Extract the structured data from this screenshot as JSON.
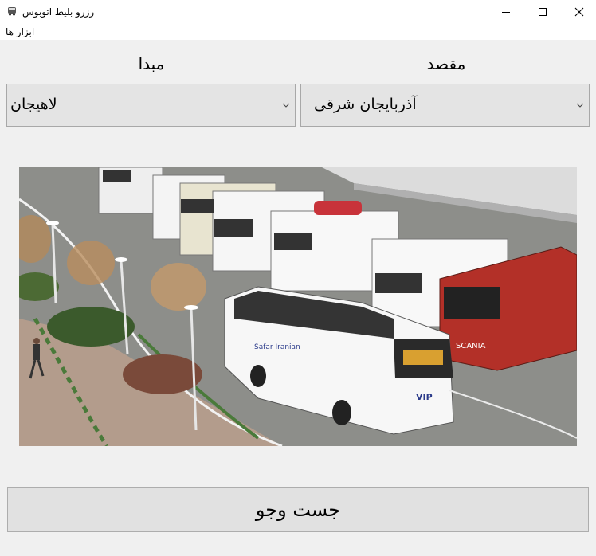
{
  "window": {
    "title": "رزرو بلیط اتوبوس",
    "icon": "bus-icon"
  },
  "menu": {
    "tools_label": "ابزار ها"
  },
  "form": {
    "destination_label": "مقصد",
    "origin_label": "مبدا",
    "destination_value": "آذربایجان شرقی",
    "origin_value": "لاهیجان",
    "search_label": "جست وجو"
  },
  "photo": {
    "bus_brand": "SCANIA",
    "bus_badge": "VIP",
    "bus_side_text": "Safar Iranian"
  }
}
